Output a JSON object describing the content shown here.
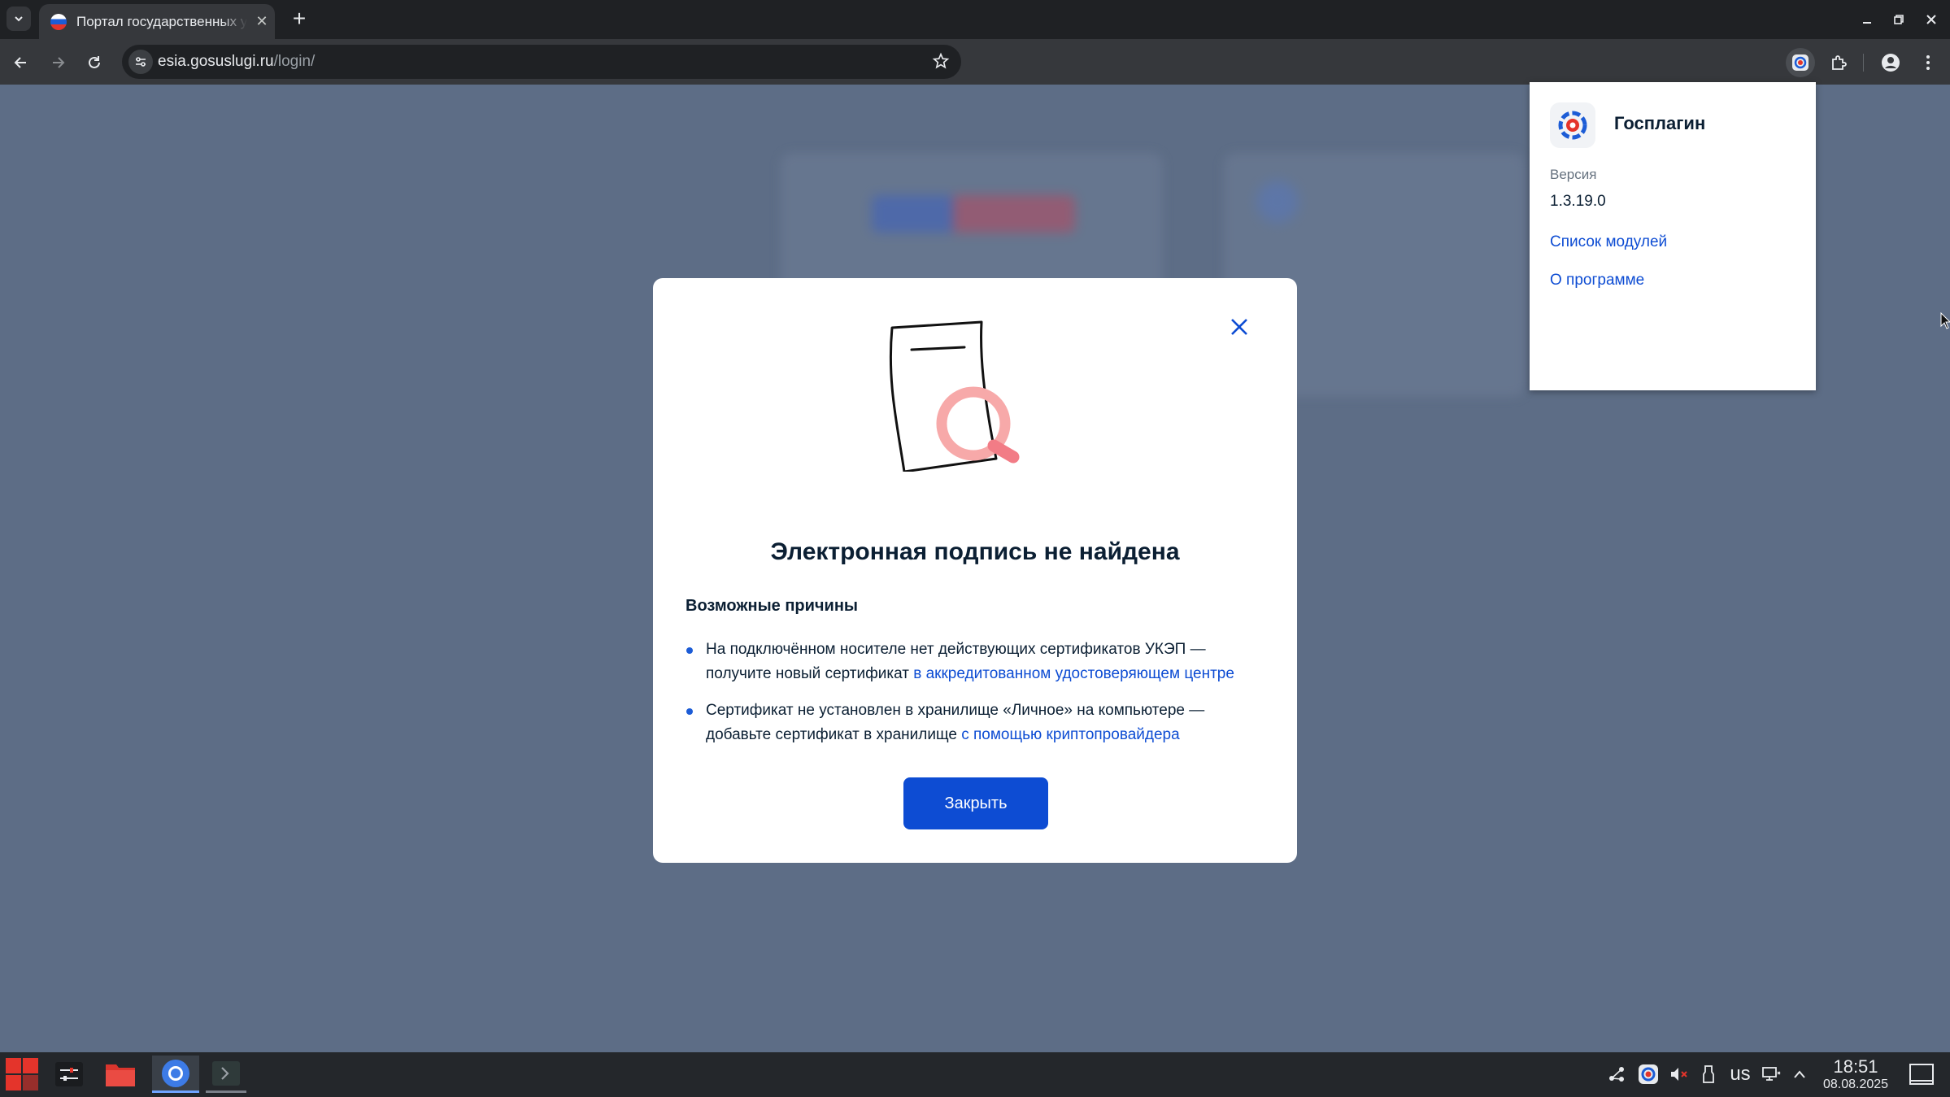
{
  "browser": {
    "tab_title": "Портал государственных услуг",
    "url_host": "esia.gosuslugi.ru",
    "url_path": "/login/"
  },
  "modal": {
    "title": "Электронная подпись не найдена",
    "reasons_heading": "Возможные причины",
    "reasons": [
      {
        "text": "На подключённом носителе нет действующих сертификатов УКЭП — получите новый сертификат ",
        "link": "в аккредитованном удостоверяющем центре"
      },
      {
        "text": "Сертификат не установлен в хранилище «Личное» на компьютере — добавьте сертификат в хранилище ",
        "link": "с помощью криптопровайдера"
      }
    ],
    "close_button_label": "Закрыть"
  },
  "extension_popup": {
    "title": "Госплагин",
    "version_label": "Версия",
    "version": "1.3.19.0",
    "links": [
      "Список модулей",
      "О программе"
    ]
  },
  "taskbar": {
    "keyboard_layout": "us",
    "time": "18:51",
    "date": "08.08.2025"
  },
  "colors": {
    "primary": "#0d4cd3",
    "text": "#0b1f33",
    "overlay": "#5d6d86",
    "accent_red": "#e4342b"
  }
}
